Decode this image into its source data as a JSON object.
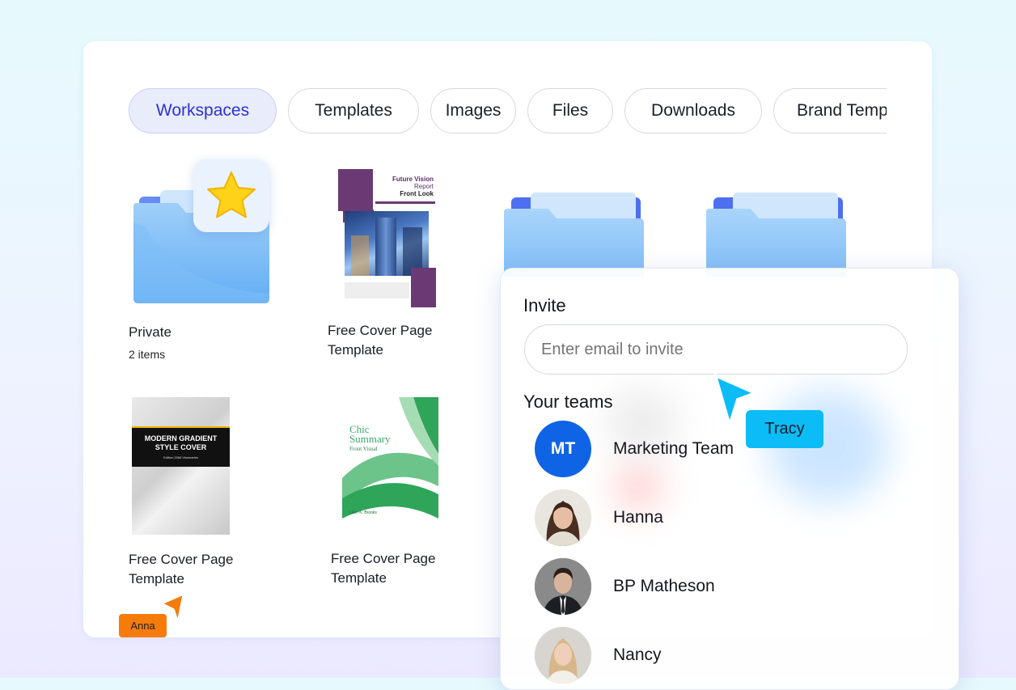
{
  "tabs": [
    {
      "label": "Workspaces",
      "active": true
    },
    {
      "label": "Templates",
      "active": false
    },
    {
      "label": "Images",
      "active": false
    },
    {
      "label": "Files",
      "active": false
    },
    {
      "label": "Downloads",
      "active": false
    },
    {
      "label": "Brand Templates",
      "active": false
    }
  ],
  "items": {
    "private": {
      "title": "Private",
      "count": "2 items",
      "icon": "star-icon"
    },
    "cover1": {
      "title_line1": "Free Cover Page",
      "title_line2": "Template",
      "thumb_heading": "Future Vision Report Front Look",
      "thumb_heading_line1": "Future Vision",
      "thumb_heading_line2": "Report",
      "thumb_heading_line3": "Front Look"
    },
    "cover2": {
      "title_line1": "Free Cover Page",
      "title_line2": "Template",
      "thumb_heading_line1": "MODERN GRADIENT",
      "thumb_heading_line2": "STYLE COVER",
      "thumb_edition": "Edition 2066 Visionaries"
    },
    "cover3": {
      "title_line1": "Free Cover Page",
      "title_line2": "Template",
      "thumb_heading_line1": "Chic",
      "thumb_heading_line2": "Summary",
      "thumb_heading_line3": "Front Visual",
      "thumb_author": "Liam K. Brooks"
    }
  },
  "invite": {
    "title": "Invite",
    "placeholder": "Enter email to invite",
    "teams_heading": "Your teams",
    "members": [
      {
        "name": "Marketing Team",
        "initials": "MT",
        "avatar": "initials"
      },
      {
        "name": "Hanna",
        "avatar": "photo"
      },
      {
        "name": "BP Matheson",
        "avatar": "photo"
      },
      {
        "name": "Nancy",
        "avatar": "photo"
      }
    ]
  },
  "cursors": [
    {
      "name": "Tracy",
      "color": "#0bbcf7"
    },
    {
      "name": "Anna",
      "color": "#f57c0a"
    }
  ],
  "colors": {
    "accent": "#2a32d6",
    "folder_blue": "#6fb6f8",
    "team_avatar": "#0f64e6"
  }
}
